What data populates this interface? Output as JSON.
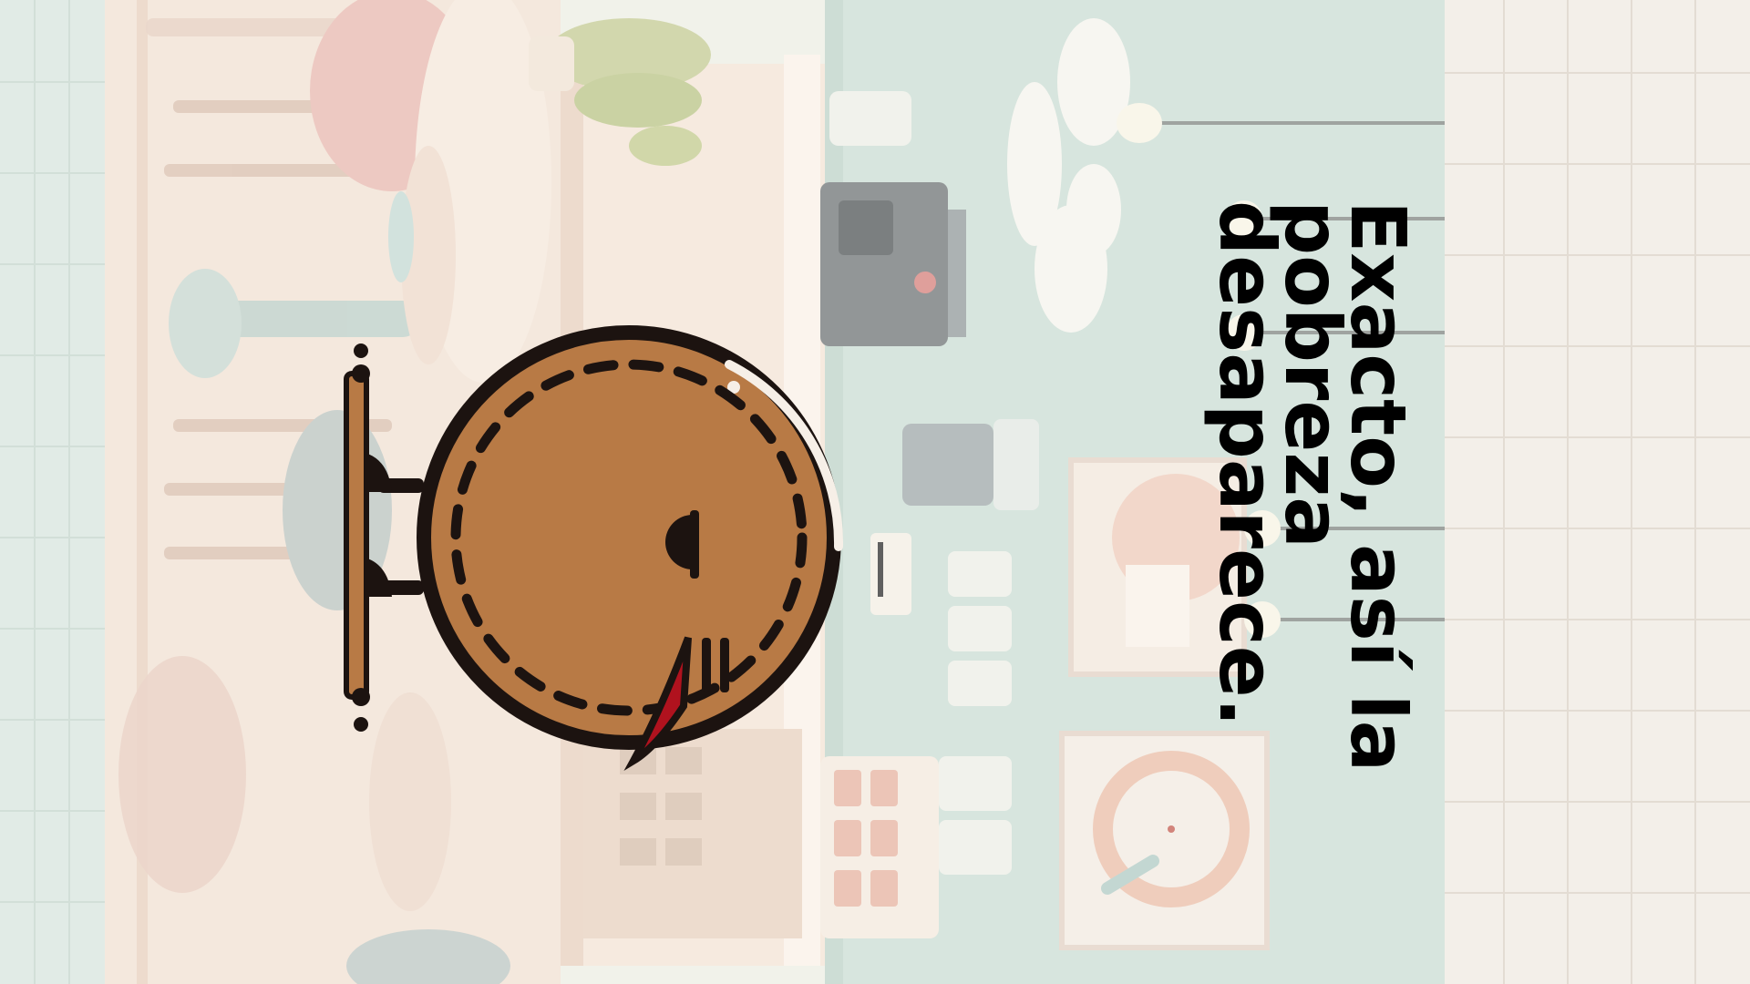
{
  "caption": {
    "text": "Exacto, así la pobreza desaparece."
  },
  "colors": {
    "wall": "#cfe0d6",
    "tile": "#dfe9e3",
    "floor": "#f3e4d6",
    "character_body": "#b87a45",
    "character_outline": "#1c1310",
    "character_mouth": "#b0121e"
  }
}
